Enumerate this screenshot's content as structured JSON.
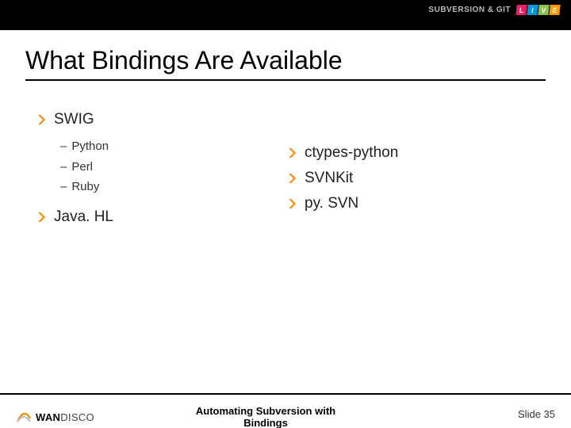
{
  "header": {
    "brand_text": "SUBVERSION & GIT",
    "live_letters": [
      "L",
      "I",
      "V",
      "E"
    ]
  },
  "title": "What Bindings Are Available",
  "left_column": {
    "items": [
      {
        "label": "SWIG",
        "subitems": [
          "Python",
          "Perl",
          "Ruby"
        ]
      },
      {
        "label": "Java. HL",
        "subitems": []
      }
    ]
  },
  "right_column": {
    "items": [
      {
        "label": "ctypes-python"
      },
      {
        "label": "SVNKit"
      },
      {
        "label": "py. SVN"
      }
    ]
  },
  "footer": {
    "company_prefix": "WAN",
    "company_suffix": "DISCO",
    "presentation_title": "Automating Subversion with Bindings",
    "slide_label": "Slide 35"
  }
}
